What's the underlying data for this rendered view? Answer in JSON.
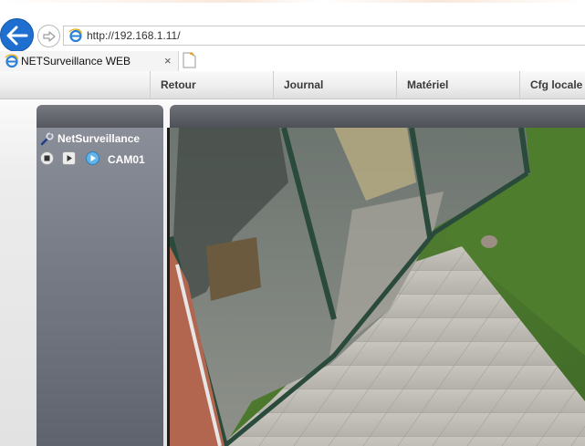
{
  "browser": {
    "url": "http://192.168.1.11/",
    "tab_title": "NETSurveillance WEB",
    "tab_close": "×",
    "icons": {
      "back": "back-arrow-icon",
      "forward": "forward-arrow-icon",
      "site": "ie-logo-icon",
      "new_tab": "new-tab-icon"
    },
    "accent_color": "#1f6fd1"
  },
  "menu": {
    "items": [
      {
        "label": "Retour"
      },
      {
        "label": "Journal"
      },
      {
        "label": "Matériel"
      },
      {
        "label": "Cfg locale"
      }
    ]
  },
  "device_tree": {
    "root_label": "NetSurveillance",
    "root_icon": "wrench-icon",
    "camera": {
      "label": "CAM01",
      "controls": [
        "stop-icon",
        "play-icon",
        "live-play-icon"
      ]
    }
  },
  "video": {
    "content": "camera-live-feed"
  }
}
